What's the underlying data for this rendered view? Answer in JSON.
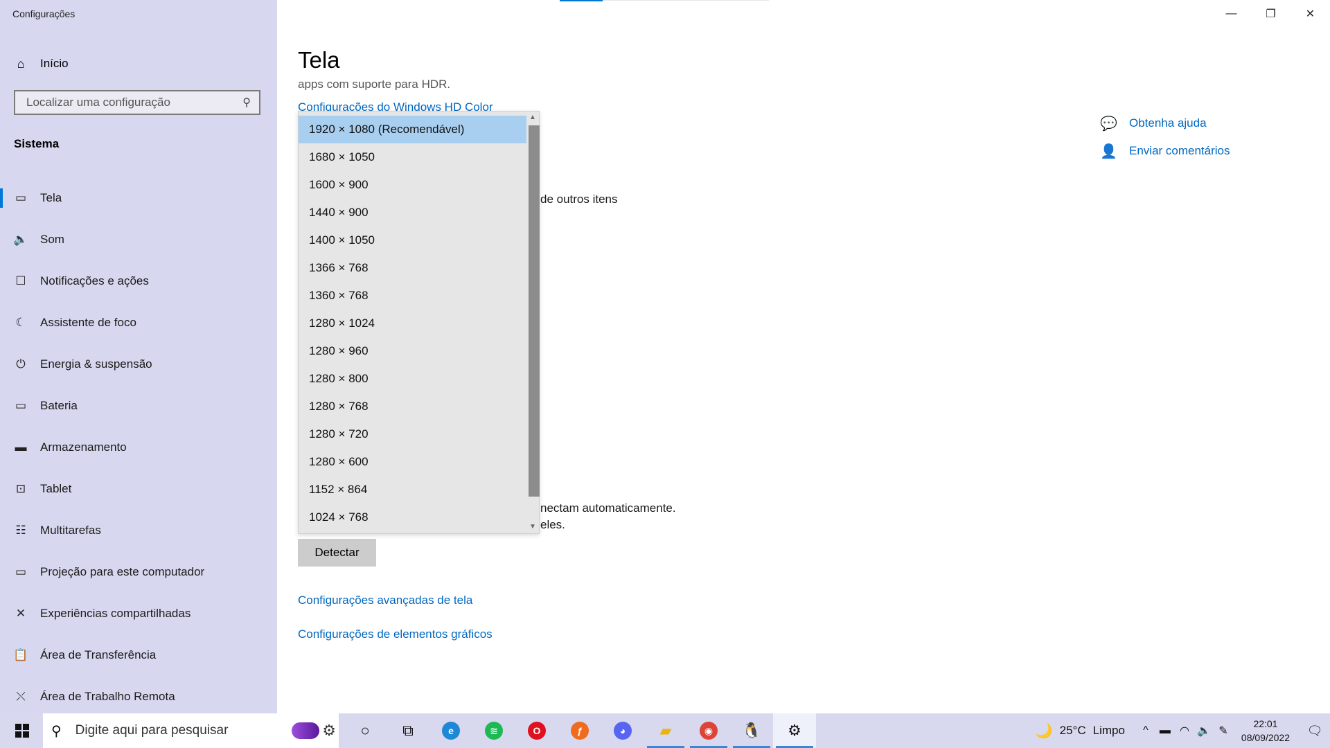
{
  "window": {
    "title": "Configurações",
    "minimize_icon": "—",
    "maximize_icon": "❐",
    "close_icon": "✕"
  },
  "sidebar": {
    "home_label": "Início",
    "search_placeholder": "Localizar uma configuração",
    "section_title": "Sistema",
    "items": [
      {
        "label": "Tela",
        "icon": "monitor-icon",
        "glyph": "▭",
        "active": true
      },
      {
        "label": "Som",
        "icon": "speaker-icon",
        "glyph": "🔈"
      },
      {
        "label": "Notificações e ações",
        "icon": "notification-icon",
        "glyph": "☐"
      },
      {
        "label": "Assistente de foco",
        "icon": "moon-icon",
        "glyph": "☾"
      },
      {
        "label": "Energia & suspensão",
        "icon": "power-icon",
        "glyph": "⏻"
      },
      {
        "label": "Bateria",
        "icon": "battery-icon",
        "glyph": "▭"
      },
      {
        "label": "Armazenamento",
        "icon": "storage-icon",
        "glyph": "▬"
      },
      {
        "label": "Tablet",
        "icon": "tablet-icon",
        "glyph": "⊡"
      },
      {
        "label": "Multitarefas",
        "icon": "multitask-icon",
        "glyph": "☷"
      },
      {
        "label": "Projeção para este computador",
        "icon": "projection-icon",
        "glyph": "▭"
      },
      {
        "label": "Experiências compartilhadas",
        "icon": "shared-icon",
        "glyph": "✕"
      },
      {
        "label": "Área de Transferência",
        "icon": "clipboard-icon",
        "glyph": "📋"
      },
      {
        "label": "Área de Trabalho Remota",
        "icon": "remote-icon",
        "glyph": "⤬"
      }
    ]
  },
  "main": {
    "title": "Tela",
    "clipped_text": "apps com suporte para HDR.",
    "hdr_link": "Configurações do Windows HD Color",
    "partial_1": "de outros itens",
    "partial_2": "nectam automaticamente.",
    "partial_3": "eles.",
    "detect_button": "Detectar",
    "link_advanced": "Configurações avançadas de tela",
    "link_graphics": "Configurações de elementos gráficos"
  },
  "help": {
    "get_help": "Obtenha ajuda",
    "feedback": "Enviar comentários"
  },
  "dropdown": {
    "options": [
      "1920 × 1080 (Recomendável)",
      "1680 × 1050",
      "1600 × 900",
      "1440 × 900",
      "1400 × 1050",
      "1366 × 768",
      "1360 × 768",
      "1280 × 1024",
      "1280 × 960",
      "1280 × 800",
      "1280 × 768",
      "1280 × 720",
      "1280 × 600",
      "1152 × 864",
      "1024 × 768"
    ],
    "selected_index": 0,
    "scroll_up_icon": "▲",
    "scroll_down_icon": "▼"
  },
  "taskbar": {
    "search_placeholder": "Digite aqui para pesquisar",
    "apps": [
      {
        "name": "cortana-icon",
        "glyph": "○",
        "color": "#111111"
      },
      {
        "name": "task-view-icon",
        "glyph": "⧉",
        "color": "#111111"
      },
      {
        "name": "edge-icon",
        "glyph": "e",
        "color": "#1e88d6",
        "circle": true
      },
      {
        "name": "spotify-icon",
        "glyph": "≋",
        "color": "#1db954",
        "circle": true
      },
      {
        "name": "opera-icon",
        "glyph": "O",
        "color": "#e0111e",
        "circle": true
      },
      {
        "name": "firefox-icon",
        "glyph": "ƒ",
        "color": "#f06b1d",
        "circle": true
      },
      {
        "name": "discord-icon",
        "glyph": "◕",
        "color": "#5865f2",
        "circle": true
      },
      {
        "name": "file-explorer-icon",
        "glyph": "▰",
        "color": "#e8b50f",
        "running": true
      },
      {
        "name": "chrome-icon",
        "glyph": "◉",
        "color": "#db4437",
        "circle": true,
        "running": true
      },
      {
        "name": "penguin-app-icon",
        "glyph": "🐧",
        "color": "#222222",
        "running": true
      },
      {
        "name": "settings-icon",
        "glyph": "⚙",
        "color": "#111111",
        "running": true,
        "active": true
      }
    ],
    "weather_temp": "25°C",
    "weather_cond": "Limpo",
    "time": "22:01",
    "date": "08/09/2022"
  }
}
